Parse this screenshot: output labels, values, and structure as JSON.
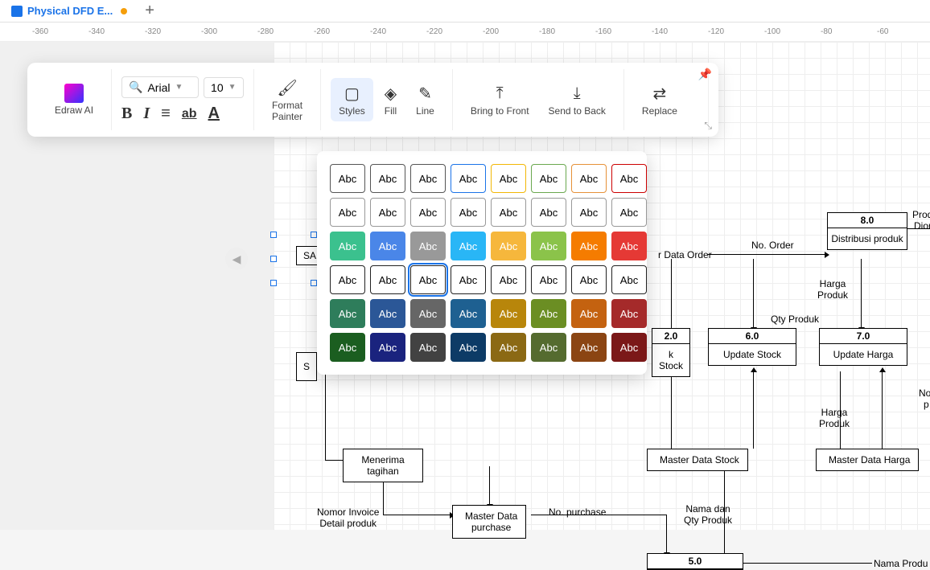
{
  "tab": {
    "title": "Physical DFD E...",
    "modified": true
  },
  "ruler": [
    -360,
    -340,
    -320,
    -300,
    -280,
    -260,
    -240,
    -220,
    -200,
    -180,
    -160,
    -140,
    -120,
    -100,
    -80,
    -60
  ],
  "toolbar": {
    "ai_label": "Edraw AI",
    "font_name": "Arial",
    "font_size": "10",
    "format_painter": "Format\nPainter",
    "styles": "Styles",
    "fill": "Fill",
    "line": "Line",
    "bring_front": "Bring to Front",
    "send_back": "Send to Back",
    "replace": "Replace"
  },
  "style_swatch_text": "Abc",
  "style_rows": [
    [
      {
        "bg": "#fff",
        "fg": "#000",
        "bd": "#555"
      },
      {
        "bg": "#fff",
        "fg": "#000",
        "bd": "#555"
      },
      {
        "bg": "#fff",
        "fg": "#000",
        "bd": "#555"
      },
      {
        "bg": "#fff",
        "fg": "#000",
        "bd": "#1a73e8"
      },
      {
        "bg": "#fff",
        "fg": "#000",
        "bd": "#f2b705"
      },
      {
        "bg": "#fff",
        "fg": "#000",
        "bd": "#6aa84f"
      },
      {
        "bg": "#fff",
        "fg": "#000",
        "bd": "#e69138"
      },
      {
        "bg": "#fff",
        "fg": "#000",
        "bd": "#cc0000"
      }
    ],
    [
      {
        "bg": "#fff",
        "fg": "#000",
        "bd": "#999"
      },
      {
        "bg": "#fff",
        "fg": "#000",
        "bd": "#999"
      },
      {
        "bg": "#fff",
        "fg": "#000",
        "bd": "#999"
      },
      {
        "bg": "#fff",
        "fg": "#000",
        "bd": "#999"
      },
      {
        "bg": "#fff",
        "fg": "#000",
        "bd": "#999"
      },
      {
        "bg": "#fff",
        "fg": "#000",
        "bd": "#999"
      },
      {
        "bg": "#fff",
        "fg": "#000",
        "bd": "#999"
      },
      {
        "bg": "#fff",
        "fg": "#000",
        "bd": "#999"
      }
    ],
    [
      {
        "bg": "#3bc18e",
        "fg": "#fff",
        "bd": "#3bc18e"
      },
      {
        "bg": "#4a86e8",
        "fg": "#fff",
        "bd": "#4a86e8"
      },
      {
        "bg": "#999999",
        "fg": "#fff",
        "bd": "#999999"
      },
      {
        "bg": "#29b6f6",
        "fg": "#fff",
        "bd": "#29b6f6"
      },
      {
        "bg": "#f6b73c",
        "fg": "#fff",
        "bd": "#f6b73c"
      },
      {
        "bg": "#8bc34a",
        "fg": "#fff",
        "bd": "#8bc34a"
      },
      {
        "bg": "#f57c00",
        "fg": "#fff",
        "bd": "#f57c00"
      },
      {
        "bg": "#e53935",
        "fg": "#fff",
        "bd": "#e53935"
      }
    ],
    [
      {
        "bg": "#fff",
        "fg": "#000",
        "bd": "#222"
      },
      {
        "bg": "#fff",
        "fg": "#000",
        "bd": "#222"
      },
      {
        "bg": "#fff",
        "fg": "#000",
        "bd": "#222",
        "sel": true
      },
      {
        "bg": "#fff",
        "fg": "#000",
        "bd": "#222"
      },
      {
        "bg": "#fff",
        "fg": "#000",
        "bd": "#222"
      },
      {
        "bg": "#fff",
        "fg": "#000",
        "bd": "#222"
      },
      {
        "bg": "#fff",
        "fg": "#000",
        "bd": "#222"
      },
      {
        "bg": "#fff",
        "fg": "#000",
        "bd": "#222"
      }
    ],
    [
      {
        "bg": "#2e7d5b",
        "fg": "#fff",
        "bd": "#2e7d5b"
      },
      {
        "bg": "#2b5797",
        "fg": "#fff",
        "bd": "#2b5797"
      },
      {
        "bg": "#666666",
        "fg": "#fff",
        "bd": "#666666"
      },
      {
        "bg": "#1e6091",
        "fg": "#fff",
        "bd": "#1e6091"
      },
      {
        "bg": "#b8860b",
        "fg": "#fff",
        "bd": "#b8860b"
      },
      {
        "bg": "#6b8e23",
        "fg": "#fff",
        "bd": "#6b8e23"
      },
      {
        "bg": "#c46210",
        "fg": "#fff",
        "bd": "#c46210"
      },
      {
        "bg": "#a52a2a",
        "fg": "#fff",
        "bd": "#a52a2a"
      }
    ],
    [
      {
        "bg": "#1b5e20",
        "fg": "#fff",
        "bd": "#1b5e20"
      },
      {
        "bg": "#1a237e",
        "fg": "#fff",
        "bd": "#1a237e"
      },
      {
        "bg": "#424242",
        "fg": "#fff",
        "bd": "#424242"
      },
      {
        "bg": "#0d3b66",
        "fg": "#fff",
        "bd": "#0d3b66"
      },
      {
        "bg": "#8b6914",
        "fg": "#fff",
        "bd": "#8b6914"
      },
      {
        "bg": "#556b2f",
        "fg": "#fff",
        "bd": "#556b2f"
      },
      {
        "bg": "#8b4513",
        "fg": "#fff",
        "bd": "#8b4513"
      },
      {
        "bg": "#7b1818",
        "fg": "#fff",
        "bd": "#7b1818"
      }
    ]
  ],
  "dfd": {
    "sa_partial": "SA",
    "s_partial": "S",
    "data_order": "r Data Order",
    "no_order": "No. Order",
    "box_8": {
      "num": "8.0",
      "txt": "Distribusi produk"
    },
    "produ_partial": "Produ",
    "dior_partial": "Dior",
    "harga_produk": "Harga\nProduk",
    "qty_produk": "Qty Produk",
    "box_2": {
      "num": "2.0",
      "txt": "k Stock"
    },
    "box_6": {
      "num": "6.0",
      "txt": "Update Stock"
    },
    "box_7": {
      "num": "7.0",
      "txt": "Update Harga"
    },
    "no_partial": "No",
    "p_partial": "p",
    "harga_produk2": "Harga\nProduk",
    "menerima_tagihan": "Menerima\ntagihan",
    "master_stock": "Master Data Stock",
    "master_harga": "Master Data Harga",
    "nomor_invoice": "Nomor Invoice\nDetail produk",
    "master_purchase": "Master Data\npurchase",
    "no_purchase": "No. purchase",
    "nama_qty": "Nama dan\nQty Produk",
    "box_5": {
      "num": "5.0"
    },
    "nama_produ": "Nama Produ"
  }
}
